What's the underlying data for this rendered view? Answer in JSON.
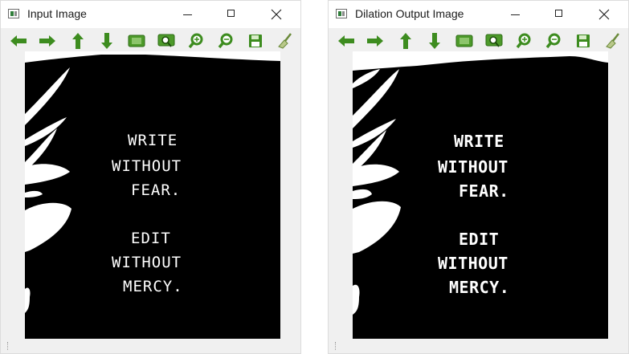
{
  "windows": [
    {
      "title": "Input Image",
      "poem": [
        "WRITE",
        "WITHOUT",
        "FEAR.",
        "EDIT",
        "WITHOUT",
        "MERCY."
      ]
    },
    {
      "title": "Dilation Output Image",
      "poem": [
        "WRITE",
        "WITHOUT",
        "FEAR.",
        "EDIT",
        "WITHOUT",
        "MERCY."
      ]
    }
  ],
  "toolbar_icons": [
    "arrow-left-icon",
    "arrow-right-icon",
    "arrow-up-icon",
    "arrow-down-icon",
    "fit-image-icon",
    "zoom-region-icon",
    "zoom-in-icon",
    "zoom-out-icon",
    "save-icon",
    "properties-brush-icon"
  ],
  "colors": {
    "accent": "#3d8c1f",
    "canvas": "#000000",
    "window_bg": "#f0f0f0"
  }
}
